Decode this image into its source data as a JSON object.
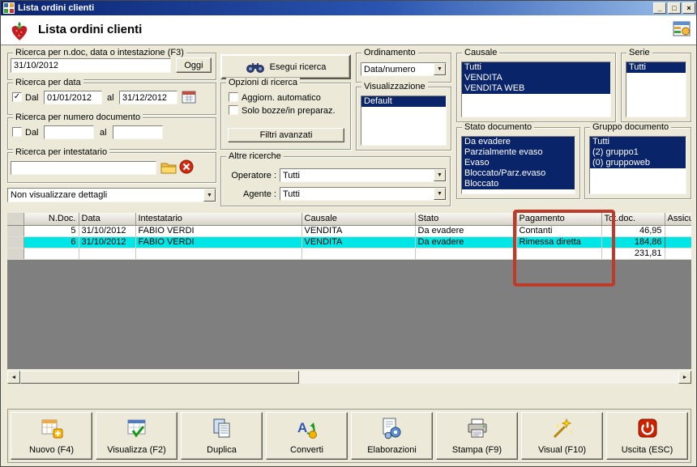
{
  "window": {
    "title": "Lista ordini clienti",
    "controls": {
      "minimize": "_",
      "maximize": "□",
      "close": "×"
    }
  },
  "header": {
    "title": "Lista ordini clienti"
  },
  "icons": {
    "dropdown": "▼",
    "scroll_left": "◄",
    "scroll_right": "►",
    "checkmark": "✓"
  },
  "filters": {
    "search_group": {
      "label": "Ricerca per n.doc, data o intestazione (F3)",
      "value": "31/10/2012",
      "oggi_button": "Oggi"
    },
    "date_group": {
      "label": "Ricerca per data",
      "dal_label": "Dal",
      "dal_value": "01/01/2012",
      "al_label": "al",
      "al_value": "31/12/2012"
    },
    "numdoc_group": {
      "label": "Ricerca per numero documento",
      "dal_label": "Dal",
      "dal_value": "",
      "al_label": "al",
      "al_value": ""
    },
    "intestatario_group": {
      "label": "Ricerca per intestatario",
      "value": ""
    },
    "dettagli_value": "Non visualizzare dettagli",
    "esegui_button": "Esegui ricerca",
    "opzioni_group": {
      "label": "Opzioni di ricerca",
      "aggiorn_label": "Aggiorn. automatico",
      "bozze_label": "Solo bozze/in preparaz.",
      "filtri_button": "Filtri avanzati"
    },
    "ordinamento_group": {
      "label": "Ordinamento",
      "value": "Data/numero"
    },
    "visualizzazione_group": {
      "label": "Visualizzazione",
      "items": [
        "Default"
      ]
    },
    "causale_group": {
      "label": "Causale",
      "items": [
        "Tutti",
        "VENDITA",
        "VENDITA WEB"
      ]
    },
    "serie_group": {
      "label": "Serie",
      "items": [
        "Tutti"
      ]
    },
    "stato_group": {
      "label": "Stato documento",
      "items": [
        "Da evadere",
        "Parzialmente evaso",
        "Evaso",
        "Bloccato/Parz.evaso",
        "Bloccato"
      ]
    },
    "gruppo_group": {
      "label": "Gruppo documento",
      "items": [
        "Tutti",
        "(2) gruppo1",
        "(0) gruppoweb"
      ]
    },
    "altre_group": {
      "label": "Altre ricerche",
      "operatore_label": "Operatore :",
      "operatore_value": "Tutti",
      "agente_label": "Agente :",
      "agente_value": "Tutti"
    }
  },
  "table": {
    "headers": [
      "N.Doc.",
      "Data",
      "Intestatario",
      "Causale",
      "Stato",
      "Pagamento",
      "Tot.doc.",
      "Assicura"
    ],
    "rows": [
      {
        "ndoc": "5",
        "data": "31/10/2012",
        "intestatario": "FABIO VERDI",
        "causale": "VENDITA",
        "stato": "Da evadere",
        "pagamento": "Contanti",
        "totdoc": "46,95"
      },
      {
        "ndoc": "6",
        "data": "31/10/2012",
        "intestatario": "FABIO VERDI",
        "causale": "VENDITA",
        "stato": "Da evadere",
        "pagamento": "Rimessa diretta",
        "totdoc": "184,86"
      }
    ],
    "total": "231,81"
  },
  "toolbar": {
    "buttons": [
      {
        "label": "Nuovo (F4)"
      },
      {
        "label": "Visualizza (F2)"
      },
      {
        "label": "Duplica"
      },
      {
        "label": "Converti"
      },
      {
        "label": "Elaborazioni"
      },
      {
        "label": "Stampa (F9)"
      },
      {
        "label": "Visual (F10)"
      },
      {
        "label": "Uscita (ESC)"
      }
    ]
  },
  "colors": {
    "titlebar_start": "#0a2472",
    "titlebar_end": "#9cc0ea",
    "selection": "#0a246a",
    "selected_row": "#00e5e5",
    "annotation": "#bf3a28"
  }
}
